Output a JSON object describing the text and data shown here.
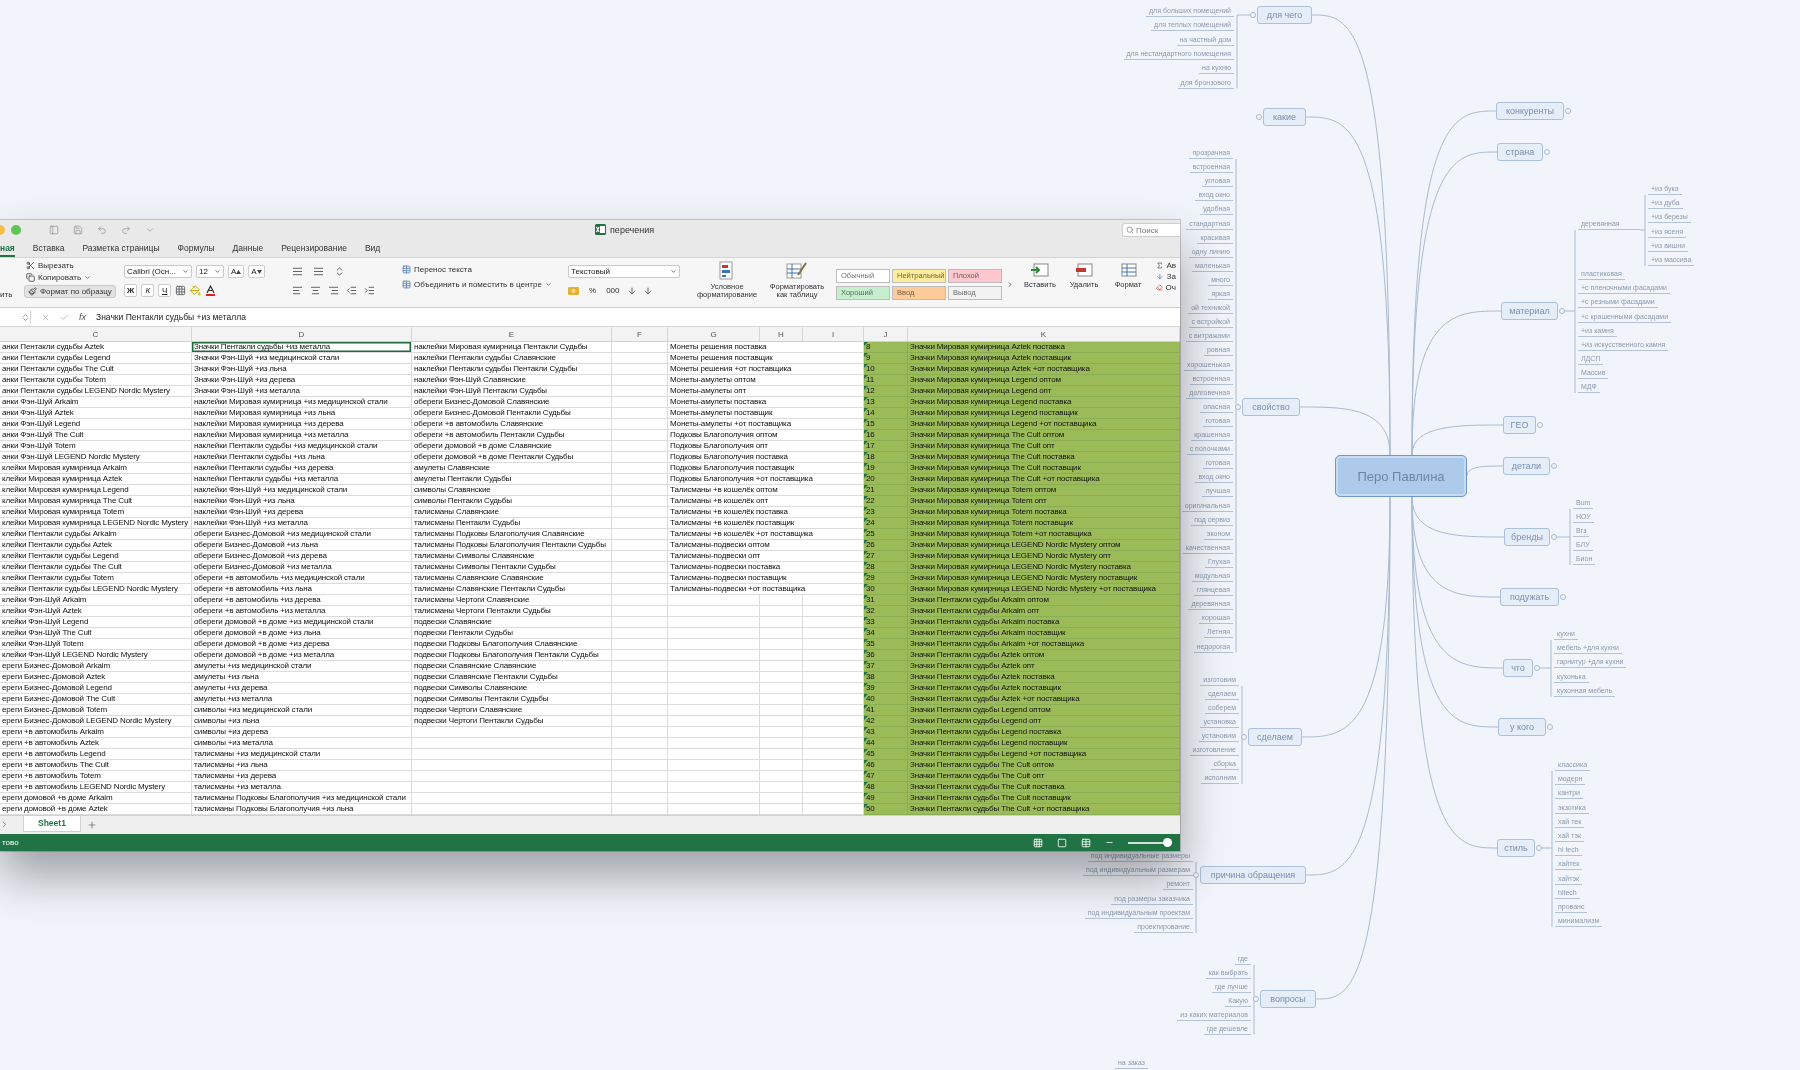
{
  "mind_map": {
    "center": "Перо Павлина",
    "branches": [
      {
        "label": "для чего",
        "children": [
          {
            "label": "для больших помещений"
          },
          {
            "label": "для теплых помещений"
          },
          {
            "label": "на частный дом"
          },
          {
            "label": "для нестандартного помещения"
          },
          {
            "label": "на кухню"
          },
          {
            "label": "для бронзового"
          }
        ]
      },
      {
        "label": "какие"
      },
      {
        "label": "свойство",
        "children": [
          {
            "label": "прозрачная"
          },
          {
            "label": "встроенная"
          },
          {
            "label": "угловая"
          },
          {
            "label": "вход окно"
          },
          {
            "label": "удобная"
          },
          {
            "label": "стандартная"
          },
          {
            "label": "красивая"
          },
          {
            "label": "одну линию"
          },
          {
            "label": "маленькая"
          },
          {
            "label": "много"
          },
          {
            "label": "яркая"
          },
          {
            "label": "ой техникой"
          },
          {
            "label": "с встройкой"
          },
          {
            "label": "с витражами"
          },
          {
            "label": "ровная"
          },
          {
            "label": "хорошенькая"
          },
          {
            "label": "встроенная"
          },
          {
            "label": "долговечная"
          },
          {
            "label": "опасная"
          },
          {
            "label": "готовая"
          },
          {
            "label": "крашенная"
          },
          {
            "label": "с полочками"
          },
          {
            "label": "готовая"
          },
          {
            "label": "вход окно"
          },
          {
            "label": "лучшая"
          },
          {
            "label": "оригинальная"
          },
          {
            "label": "под сервиз"
          },
          {
            "label": "эконом"
          },
          {
            "label": "качественная"
          },
          {
            "label": "Глухая"
          },
          {
            "label": "модульная"
          },
          {
            "label": "глянцевая"
          },
          {
            "label": "деревянная"
          },
          {
            "label": "хорошая"
          },
          {
            "label": "Летняя"
          },
          {
            "label": "недорогая"
          }
        ]
      },
      {
        "label": "сделаем",
        "children": [
          {
            "label": "изготовим"
          },
          {
            "label": "сделаем"
          },
          {
            "label": "соберем"
          },
          {
            "label": "установка"
          },
          {
            "label": "установим"
          },
          {
            "label": "изготовление"
          },
          {
            "label": "сборка"
          },
          {
            "label": "исполним"
          }
        ]
      },
      {
        "label": "причина обращения",
        "children": [
          {
            "label": "под индивидуальные размеры"
          },
          {
            "label": "под индивидуальным размерам"
          },
          {
            "label": "ремонт"
          },
          {
            "label": "под размеры заказчика"
          },
          {
            "label": "под индивидуальным проектам"
          },
          {
            "label": "проектирование"
          }
        ]
      },
      {
        "label": "вопросы",
        "children": [
          {
            "label": "где"
          },
          {
            "label": "как выбрать"
          },
          {
            "label": "где лучше"
          },
          {
            "label": "Какую"
          },
          {
            "label": "из каких материалов"
          },
          {
            "label": "где дешевле"
          }
        ]
      },
      {
        "label": "конкуренты"
      },
      {
        "label": "страна"
      },
      {
        "label": "материал",
        "children": [
          {
            "label": "деревянная",
            "children": [
              {
                "label": "+из бука"
              },
              {
                "label": "+из дуба"
              },
              {
                "label": "+из березы"
              },
              {
                "label": "+из ясеня"
              },
              {
                "label": "+из вишни"
              },
              {
                "label": "+из массива"
              }
            ]
          },
          {
            "label": "пластиковая"
          },
          {
            "label": "+с пленочными фасадами"
          },
          {
            "label": "+с резными фасадами"
          },
          {
            "label": "+с крашенными фасадами"
          },
          {
            "label": "+из камня"
          },
          {
            "label": "+из искусственного камня"
          },
          {
            "label": "ЛДСП"
          },
          {
            "label": "Массив"
          },
          {
            "label": "МДФ"
          }
        ]
      },
      {
        "label": "ГЕО"
      },
      {
        "label": "детали"
      },
      {
        "label": "бренды",
        "children": [
          {
            "label": "Bum"
          },
          {
            "label": "НОУ"
          },
          {
            "label": "Вгз"
          },
          {
            "label": "БЛУ"
          },
          {
            "label": "Бион"
          }
        ]
      },
      {
        "label": "подужать"
      },
      {
        "label": "что",
        "children": [
          {
            "label": "кухни"
          },
          {
            "label": "мебель +для кухни"
          },
          {
            "label": "гарнитур +для кухни"
          },
          {
            "label": "кухонька"
          },
          {
            "label": "кухонная мебель"
          }
        ]
      },
      {
        "label": "у кого"
      },
      {
        "label": "стиль",
        "children": [
          {
            "label": "классика"
          },
          {
            "label": "модерн"
          },
          {
            "label": "кантри"
          },
          {
            "label": "экзотика"
          },
          {
            "label": "хай тек"
          },
          {
            "label": "хай тэк"
          },
          {
            "label": "hi tech"
          },
          {
            "label": "хайтек"
          },
          {
            "label": "хайтэк"
          },
          {
            "label": "hitech"
          },
          {
            "label": "прованс"
          },
          {
            "label": "минимализм"
          }
        ]
      }
    ],
    "loose_leaves": [
      {
        "label": "на заказ"
      }
    ]
  },
  "excel": {
    "title": "перечения",
    "search": {
      "placeholder": "Поиск"
    },
    "tabs": [
      {
        "label": "ная",
        "selected": true
      },
      {
        "label": "Вставка",
        "selected": false
      },
      {
        "label": "Разметка страницы",
        "selected": false
      },
      {
        "label": "Формулы",
        "selected": false
      },
      {
        "label": "Данные",
        "selected": false
      },
      {
        "label": "Рецензирование",
        "selected": false
      },
      {
        "label": "Вид",
        "selected": false
      }
    ],
    "clipboard": {
      "paste": "ить",
      "cut": "Вырезать",
      "copy": "Копировать",
      "format_painter": "Формат по образцу"
    },
    "font": {
      "name": "Calibri (Осн...",
      "size": "12",
      "grow": "A",
      "shrink": "A",
      "bold": "Ж",
      "italic": "К",
      "underline": "Ч"
    },
    "alignment": {
      "wrap": "Перенос текста",
      "merge": "Объединить и поместить в центре"
    },
    "number": {
      "format": "Текстовый",
      "percent": "%",
      "thousands": "000"
    },
    "conditional": "Условное форматирование",
    "format_table": "Форматировать как таблицу",
    "styles": [
      {
        "label": "Обычный",
        "color": "#ffffff"
      },
      {
        "label": "Нейтральный",
        "color": "#ffeb9c"
      },
      {
        "label": "Плохой",
        "color": "#ffc7ce"
      },
      {
        "label": "Хороший",
        "color": "#c6efce"
      },
      {
        "label": "Ввод",
        "color": "#ffcc99"
      },
      {
        "label": "Вывод",
        "color": "#f2f2f2"
      }
    ],
    "cells": [
      "Вставить",
      "Удалить",
      "Формат"
    ],
    "editing": [
      "Ав",
      "За",
      "Оч"
    ],
    "fx": "fx",
    "formula": "Значки Пентакли судьбы +из металла",
    "columns": [
      "C",
      "D",
      "E",
      "F",
      "G",
      "H",
      "I",
      "J",
      "K"
    ],
    "rows": [
      {
        "selected": true,
        "c": "анки Пентакли судьбы Aztek",
        "d": "Значки Пентакли судьбы +из металла",
        "e": "наклейки Мировая кумирница Пентакли Судьбы",
        "g": "Монеты решения поставка",
        "j": "8",
        "k": "Значки Мировая кумирница Aztek поставка"
      },
      {
        "selected": false,
        "c": "анки Пентакли судьбы Legend",
        "d": "Значки Фэн-Шуй +из медицинской стали",
        "e": "наклейки Пентакли судьбы Славянские",
        "g": "Монеты решения поставщик",
        "j": "9",
        "k": "Значки Мировая кумирница Aztek поставщик"
      },
      {
        "selected": false,
        "c": "анки Пентакли судьбы The Cult",
        "d": "Значки Фэн-Шуй +из льна",
        "e": "наклейки Пентакли судьбы Пентакли Судьбы",
        "g": "Монеты решения +от поставщика",
        "j": "10",
        "k": "Значки Мировая кумирница Aztek +от поставщика"
      },
      {
        "selected": false,
        "c": "анки Пентакли судьбы Totem",
        "d": "Значки Фэн-Шуй +из дерева",
        "e": "наклейки Фэн-Шуй Славянские",
        "g": "Монеты-амулеты оптом",
        "j": "11",
        "k": "Значки Мировая кумирница Legend оптом"
      },
      {
        "selected": false,
        "c": "анки Пентакли судьбы LEGEND Nordic Mystery",
        "d": "Значки Фэн-Шуй +из металла",
        "e": "наклейки Фэн-Шуй Пентакли Судьбы",
        "g": "Монеты-амулеты опт",
        "j": "12",
        "k": "Значки Мировая кумирница Legend опт"
      },
      {
        "selected": false,
        "c": "анки Фэн-Шуй Arkaim",
        "d": "наклейки Мировая кумирница +из медицинской стали",
        "e": "обереги Бизнес-Домовой Славянские",
        "g": "Монеты-амулеты поставка",
        "j": "13",
        "k": "Значки Мировая кумирница Legend поставка"
      },
      {
        "selected": false,
        "c": "анки Фэн-Шуй Aztek",
        "d": "наклейки Мировая кумирница +из льна",
        "e": "обереги Бизнес-Домовой Пентакли Судьбы",
        "g": "Монеты-амулеты поставщик",
        "j": "14",
        "k": "Значки Мировая кумирница Legend поставщик"
      },
      {
        "selected": false,
        "c": "анки Фэн-Шуй Legend",
        "d": "наклейки Мировая кумирница +из дерева",
        "e": "обереги +в автомобиль Славянские",
        "g": "Монеты-амулеты +от поставщика",
        "j": "15",
        "k": "Значки Мировая кумирница Legend +от поставщика"
      },
      {
        "selected": false,
        "c": "анки Фэн-Шуй The Cult",
        "d": "наклейки Мировая кумирница +из металла",
        "e": "обереги +в автомобиль Пентакли Судьбы",
        "g": "Подковы Благополучия оптом",
        "j": "16",
        "k": "Значки Мировая кумирница The Cult оптом"
      },
      {
        "selected": false,
        "c": "анки Фэн-Шуй Totem",
        "d": "наклейки Пентакли судьбы +из медицинской стали",
        "e": "обереги домовой +в доме Славянские",
        "g": "Подковы Благополучия опт",
        "j": "17",
        "k": "Значки Мировая кумирница The Cult опт"
      },
      {
        "selected": false,
        "c": "анки Фэн-Шуй LEGEND Nordic Mystery",
        "d": "наклейки Пентакли судьбы +из льна",
        "e": "обереги домовой +в доме Пентакли Судьбы",
        "g": "Подковы Благополучия поставка",
        "j": "18",
        "k": "Значки Мировая кумирница The Cult поставка"
      },
      {
        "selected": false,
        "c": "клейки Мировая кумирница Arkaim",
        "d": "наклейки Пентакли судьбы +из дерева",
        "e": "амулеты Славянские",
        "g": "Подковы Благополучия поставщик",
        "j": "19",
        "k": "Значки Мировая кумирница The Cult поставщик"
      },
      {
        "selected": false,
        "c": "клейки Мировая кумирница Aztek",
        "d": "наклейки Пентакли судьбы +из металла",
        "e": "амулеты Пентакли Судьбы",
        "g": "Подковы Благополучия +от поставщика",
        "j": "20",
        "k": "Значки Мировая кумирница The Cult +от поставщика"
      },
      {
        "selected": false,
        "c": "клейки Мировая кумирница Legend",
        "d": "наклейки Фэн-Шуй +из медицинской стали",
        "e": "символы Славянские",
        "g": "Талисманы +в кошелёк оптом",
        "j": "21",
        "k": "Значки Мировая кумирница Totem оптом"
      },
      {
        "selected": false,
        "c": "клейки Мировая кумирница The Cult",
        "d": "наклейки Фэн-Шуй +из льна",
        "e": "символы Пентакли Судьбы",
        "g": "Талисманы +в кошелёк опт",
        "j": "22",
        "k": "Значки Мировая кумирница Totem опт"
      },
      {
        "selected": false,
        "c": "клейки Мировая кумирница Totem",
        "d": "наклейки Фэн-Шуй +из дерева",
        "e": "талисманы Славянские",
        "g": "Талисманы +в кошелёк поставка",
        "j": "23",
        "k": "Значки Мировая кумирница Totem поставка"
      },
      {
        "selected": false,
        "c": "клейки Мировая кумирница LEGEND Nordic Mystery",
        "d": "наклейки Фэн-Шуй +из металла",
        "e": "талисманы Пентакли Судьбы",
        "g": "Талисманы +в кошелёк поставщик",
        "j": "24",
        "k": "Значки Мировая кумирница Totem поставщик"
      },
      {
        "selected": false,
        "c": "клейки Пентакли судьбы Arkaim",
        "d": "обереги Бизнес-Домовой +из медицинской стали",
        "e": "талисманы Подковы Благополучия Славянские",
        "g": "Талисманы +в кошелёк +от поставщика",
        "j": "25",
        "k": "Значки Мировая кумирница Totem +от поставщика"
      },
      {
        "selected": false,
        "c": "клейки Пентакли судьбы Aztek",
        "d": "обереги Бизнес-Домовой +из льна",
        "e": "талисманы Подковы Благополучия Пентакли Судьбы",
        "g": "Талисманы-подвески оптом",
        "j": "26",
        "k": "Значки Мировая кумирница LEGEND Nordic Mystery оптом"
      },
      {
        "selected": false,
        "c": "клейки Пентакли судьбы Legend",
        "d": "обереги Бизнес-Домовой +из дерева",
        "e": "талисманы Символы Славянские",
        "g": "Талисманы-подвески опт",
        "j": "27",
        "k": "Значки Мировая кумирница LEGEND Nordic Mystery опт"
      },
      {
        "selected": false,
        "c": "клейки Пентакли судьбы The Cult",
        "d": "обереги Бизнес-Домовой +из металла",
        "e": "талисманы Символы Пентакли Судьбы",
        "g": "Талисманы-подвески поставка",
        "j": "28",
        "k": "Значки Мировая кумирница LEGEND Nordic Mystery поставка"
      },
      {
        "selected": false,
        "c": "клейки Пентакли судьбы Totem",
        "d": "обереги +в автомобиль +из медицинской стали",
        "e": "талисманы Славянские Славянские",
        "g": "Талисманы-подвески поставщик",
        "j": "29",
        "k": "Значки Мировая кумирница LEGEND Nordic Mystery поставщик"
      },
      {
        "selected": false,
        "c": "клейки Пентакли судьбы LEGEND Nordic Mystery",
        "d": "обереги +в автомобиль +из льна",
        "e": "талисманы Славянские Пентакли Судьбы",
        "g": "Талисманы-подвески +от поставщика",
        "j": "30",
        "k": "Значки Мировая кумирница LEGEND Nordic Mystery +от поставщика"
      },
      {
        "selected": false,
        "c": "клейки Фэн-Шуй Arkaim",
        "d": "обереги +в автомобиль +из дерева",
        "e": "талисманы Чертоги Славянские",
        "j": "31",
        "k": "Значки Пентакли судьбы Arkaim оптом"
      },
      {
        "selected": false,
        "c": "клейки Фэн-Шуй Aztek",
        "d": "обереги +в автомобиль +из металла",
        "e": "талисманы Чертоги Пентакли Судьбы",
        "j": "32",
        "k": "Значки Пентакли судьбы Arkaim опт"
      },
      {
        "selected": false,
        "c": "клейки Фэн-Шуй Legend",
        "d": "обереги домовой +в доме +из медицинской стали",
        "e": "подвески Славянские",
        "j": "33",
        "k": "Значки Пентакли судьбы Arkaim поставка"
      },
      {
        "selected": false,
        "c": "клейки Фэн-Шуй The Cult",
        "d": "обереги домовой +в доме +из льна",
        "e": "подвески Пентакли Судьбы",
        "j": "34",
        "k": "Значки Пентакли судьбы Arkaim поставщик"
      },
      {
        "selected": false,
        "c": "клейки Фэн-Шуй Totem",
        "d": "обереги домовой +в доме +из дерева",
        "e": "подвески Подковы Благополучия Славянские",
        "j": "35",
        "k": "Значки Пентакли судьбы Arkaim +от поставщика"
      },
      {
        "selected": false,
        "c": "клейки Фэн-Шуй LEGEND Nordic Mystery",
        "d": "обереги домовой +в доме +из металла",
        "e": "подвески Подковы Благополучия Пентакли Судьбы",
        "j": "36",
        "k": "Значки Пентакли судьбы Aztek оптом"
      },
      {
        "selected": false,
        "c": "ереги Бизнес-Домовой Arkaim",
        "d": "амулеты +из медицинской стали",
        "e": "подвески Славянские Славянские",
        "j": "37",
        "k": "Значки Пентакли судьбы Aztek опт"
      },
      {
        "selected": false,
        "c": "ереги Бизнес-Домовой Aztek",
        "d": "амулеты +из льна",
        "e": "подвески Славянские Пентакли Судьбы",
        "j": "38",
        "k": "Значки Пентакли судьбы Aztek поставка"
      },
      {
        "selected": false,
        "c": "ереги Бизнес-Домовой Legend",
        "d": "амулеты +из дерева",
        "e": "подвески Символы Славянские",
        "j": "39",
        "k": "Значки Пентакли судьбы Aztek поставщик"
      },
      {
        "selected": false,
        "c": "ереги Бизнес-Домовой The Cult",
        "d": "амулеты +из металла",
        "e": "подвески Символы Пентакли Судьбы",
        "j": "40",
        "k": "Значки Пентакли судьбы Aztek +от поставщика"
      },
      {
        "selected": false,
        "c": "ереги Бизнес-Домовой Totem",
        "d": "символы +из медицинской стали",
        "e": "подвески Чертоги Славянские",
        "j": "41",
        "k": "Значки Пентакли судьбы Legend оптом"
      },
      {
        "selected": false,
        "c": "ереги Бизнес-Домовой LEGEND Nordic Mystery",
        "d": "символы +из льна",
        "e": "подвески Чертоги Пентакли Судьбы",
        "j": "42",
        "k": "Значки Пентакли судьбы Legend опт"
      },
      {
        "selected": false,
        "c": "ереги +в автомобиль Arkaim",
        "d": "символы +из дерева",
        "j": "43",
        "k": "Значки Пентакли судьбы Legend поставка"
      },
      {
        "selected": false,
        "c": "ереги +в автомобиль Aztek",
        "d": "символы +из металла",
        "j": "44",
        "k": "Значки Пентакли судьбы Legend поставщик"
      },
      {
        "selected": false,
        "c": "ереги +в автомобиль Legend",
        "d": "талисманы +из медицинской стали",
        "j": "45",
        "k": "Значки Пентакли судьбы Legend +от поставщика"
      },
      {
        "selected": false,
        "c": "ереги +в автомобиль The Cult",
        "d": "талисманы +из льна",
        "j": "46",
        "k": "Значки Пентакли судьбы The Cult оптом"
      },
      {
        "selected": false,
        "c": "ереги +в автомобиль Totem",
        "d": "талисманы +из дерева",
        "j": "47",
        "k": "Значки Пентакли судьбы The Cult опт"
      },
      {
        "selected": false,
        "c": "ереги +в автомобиль LEGEND Nordic Mystery",
        "d": "талисманы +из металла",
        "j": "48",
        "k": "Значки Пентакли судьбы The Cult поставка"
      },
      {
        "selected": false,
        "c": "ереги домовой +в доме Arkaim",
        "d": "талисманы Подковы Благополучия +из медицинской стали",
        "j": "49",
        "k": "Значки Пентакли судьбы The Cult поставщик"
      },
      {
        "selected": false,
        "c": "ереги домовой +в доме Aztek",
        "d": "талисманы Подковы Благополучия +из льна",
        "j": "50",
        "k": "Значки Пентакли судьбы The Cult +от поставщика"
      }
    ],
    "sheets": [
      {
        "label": "Sheet1",
        "selected": true
      }
    ],
    "status": "тово",
    "zoom": {
      "level": 0.9
    }
  }
}
